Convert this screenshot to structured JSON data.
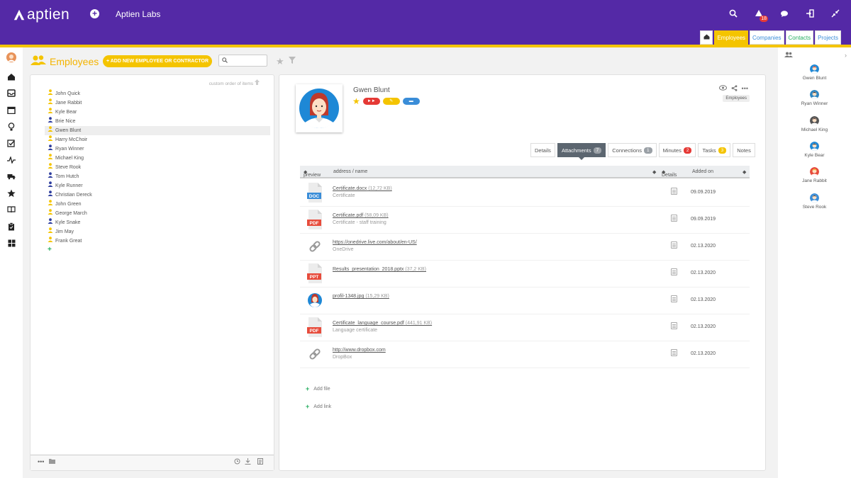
{
  "app": {
    "logo_text": "aptien",
    "company": "Aptien Labs",
    "notification_count": "18",
    "tabs": [
      {
        "label": "Employees"
      },
      {
        "label": "Companies"
      },
      {
        "label": "Contacts"
      },
      {
        "label": "Projects"
      }
    ]
  },
  "page": {
    "title": "Employees",
    "add_button": "+ ADD NEW EMPLOYEE OR CONTRACTOR",
    "search_placeholder": ""
  },
  "list": {
    "custom_order": "custom order of items",
    "selected_index": 4,
    "items": [
      {
        "name": "John Quick",
        "color": "#f4c400"
      },
      {
        "name": "Jane Rabbit",
        "color": "#f4c400"
      },
      {
        "name": "Kyle Bear",
        "color": "#f4c400"
      },
      {
        "name": "Brie Nice",
        "color": "#2e3e9e"
      },
      {
        "name": "Gwen Blunt",
        "color": "#f4c400"
      },
      {
        "name": "Harry McChoir",
        "color": "#f4c400"
      },
      {
        "name": "Ryan Winner",
        "color": "#2e3e9e"
      },
      {
        "name": "Michael King",
        "color": "#f4c400"
      },
      {
        "name": "Steve Rook",
        "color": "#f4c400"
      },
      {
        "name": "Tom Hutch",
        "color": "#2e3e9e"
      },
      {
        "name": "Kyle Runner",
        "color": "#2e3e9e"
      },
      {
        "name": "Christian Dereck",
        "color": "#2e3e9e"
      },
      {
        "name": "John Green",
        "color": "#f4c400"
      },
      {
        "name": "George March",
        "color": "#f4c400"
      },
      {
        "name": "Kyle Snake",
        "color": "#2e3e9e"
      },
      {
        "name": "Jim May",
        "color": "#f4c400"
      },
      {
        "name": "Frank Great",
        "color": "#f4c400"
      }
    ]
  },
  "detail": {
    "name": "Gwen Blunt",
    "group_chip": "Employees",
    "tabs": [
      {
        "label": "Details",
        "count": ""
      },
      {
        "label": "Attachments",
        "count": "7",
        "active": true,
        "color": "#9aa0a6"
      },
      {
        "label": "Connections",
        "count": "1",
        "color": "#9aa0a6"
      },
      {
        "label": "Minutes",
        "count": "2",
        "color": "#e53935"
      },
      {
        "label": "Tasks",
        "count": "3",
        "color": "#f4c400"
      },
      {
        "label": "Notes",
        "count": ""
      }
    ],
    "table_headers": {
      "preview": "preview",
      "address": "address / name",
      "details": "Details",
      "added": "Added on"
    },
    "attachments": [
      {
        "type": "doc",
        "icon_label": "DOC",
        "name": "Certificate.docx",
        "size": "(12,72 KB)",
        "desc": "Certificate",
        "date": "09.09.2019"
      },
      {
        "type": "pdf",
        "icon_label": "PDF",
        "name": "Certificate.pdf",
        "size": "(58,09 KB)",
        "desc": "Certificate - staff training",
        "date": "09.09.2019"
      },
      {
        "type": "link",
        "icon_label": "",
        "name": "https://onedrive.live.com/about/en-US/",
        "size": "",
        "desc": "OneDrive",
        "date": "02.13.2020"
      },
      {
        "type": "ppt",
        "icon_label": "PPT",
        "name": "Results_presentation_2018.pptx",
        "size": "(37,2 KB)",
        "desc": "",
        "date": "02.13.2020"
      },
      {
        "type": "img",
        "icon_label": "",
        "name": "profil-1348.jpg",
        "size": "(15,29 KB)",
        "desc": "",
        "date": "02.13.2020"
      },
      {
        "type": "pdf",
        "icon_label": "PDF",
        "name": "Certificate_language_course.pdf",
        "size": "(441,91 KB)",
        "desc": "Language certificate",
        "date": "02.13.2020"
      },
      {
        "type": "link",
        "icon_label": "",
        "name": "http://www.dropbox.com",
        "size": "",
        "desc": "DropBox",
        "date": "02.13.2020"
      }
    ],
    "add_file": "Add file",
    "add_link": "Add link"
  },
  "right_sidebar": {
    "users": [
      {
        "name": "Gwen Blunt"
      },
      {
        "name": "Ryan Winner"
      },
      {
        "name": "Michael King"
      },
      {
        "name": "Kyle Bear"
      },
      {
        "name": "Jane Rabbit"
      },
      {
        "name": "Steve Rook"
      }
    ]
  }
}
